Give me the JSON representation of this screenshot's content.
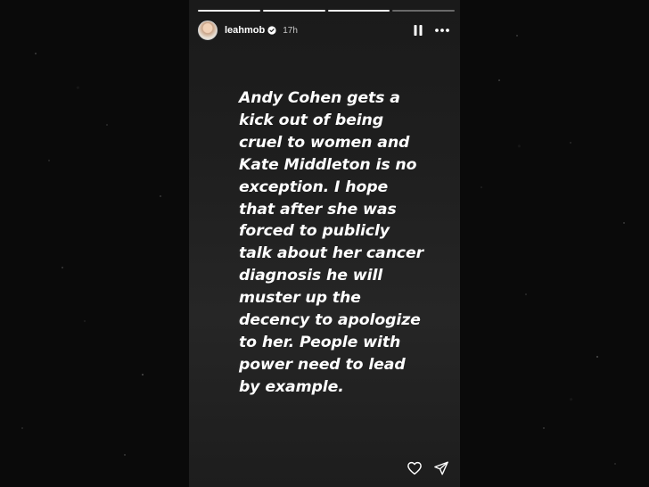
{
  "story": {
    "username": "leahmob",
    "time_ago": "17h",
    "progress_segments": [
      {
        "state": "done"
      },
      {
        "state": "done"
      },
      {
        "state": "done"
      },
      {
        "state": "pending"
      }
    ],
    "caption_lines": [
      "Andy Cohen gets a",
      "kick out of being",
      "cruel to women and",
      "Kate Middleton is no",
      "exception. I hope",
      "that after she was",
      "forced to publicly",
      "talk about her cancer",
      "diagnosis he will",
      "muster up the",
      "decency to apologize",
      "to her. People with",
      "power need to lead",
      "by example."
    ],
    "icons": {
      "verified": "verified-badge-icon",
      "pause": "pause-icon",
      "more": "more-options-icon",
      "like": "heart-icon",
      "share": "send-icon"
    }
  }
}
